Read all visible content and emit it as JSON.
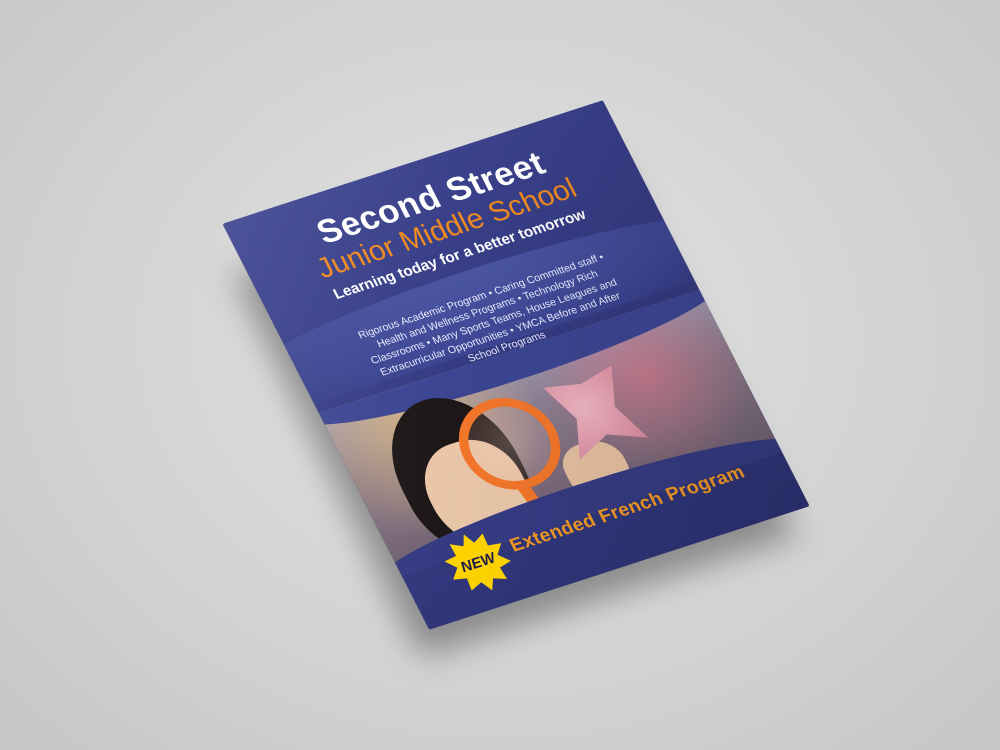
{
  "flyer": {
    "title": "Second Street",
    "subtitle": "Junior Middle School",
    "tagline": "Learning today for a better tomorrow",
    "features_lines": [
      "Rigorous Academic Program • Caring Committed staff •",
      "Health and Wellness Programs • Technology Rich",
      "Classrooms • Many Sports Teams, House Leagues and",
      "Extracurricular Opportunities • YMCA Before and After",
      "School Programs"
    ],
    "badge": "NEW",
    "program": "Extended French Program"
  },
  "colors": {
    "flyer_blue": "#3d4590",
    "accent_orange": "#f08a1e",
    "badge_yellow": "#ffd400",
    "background_gray": "#d2d2d2"
  }
}
